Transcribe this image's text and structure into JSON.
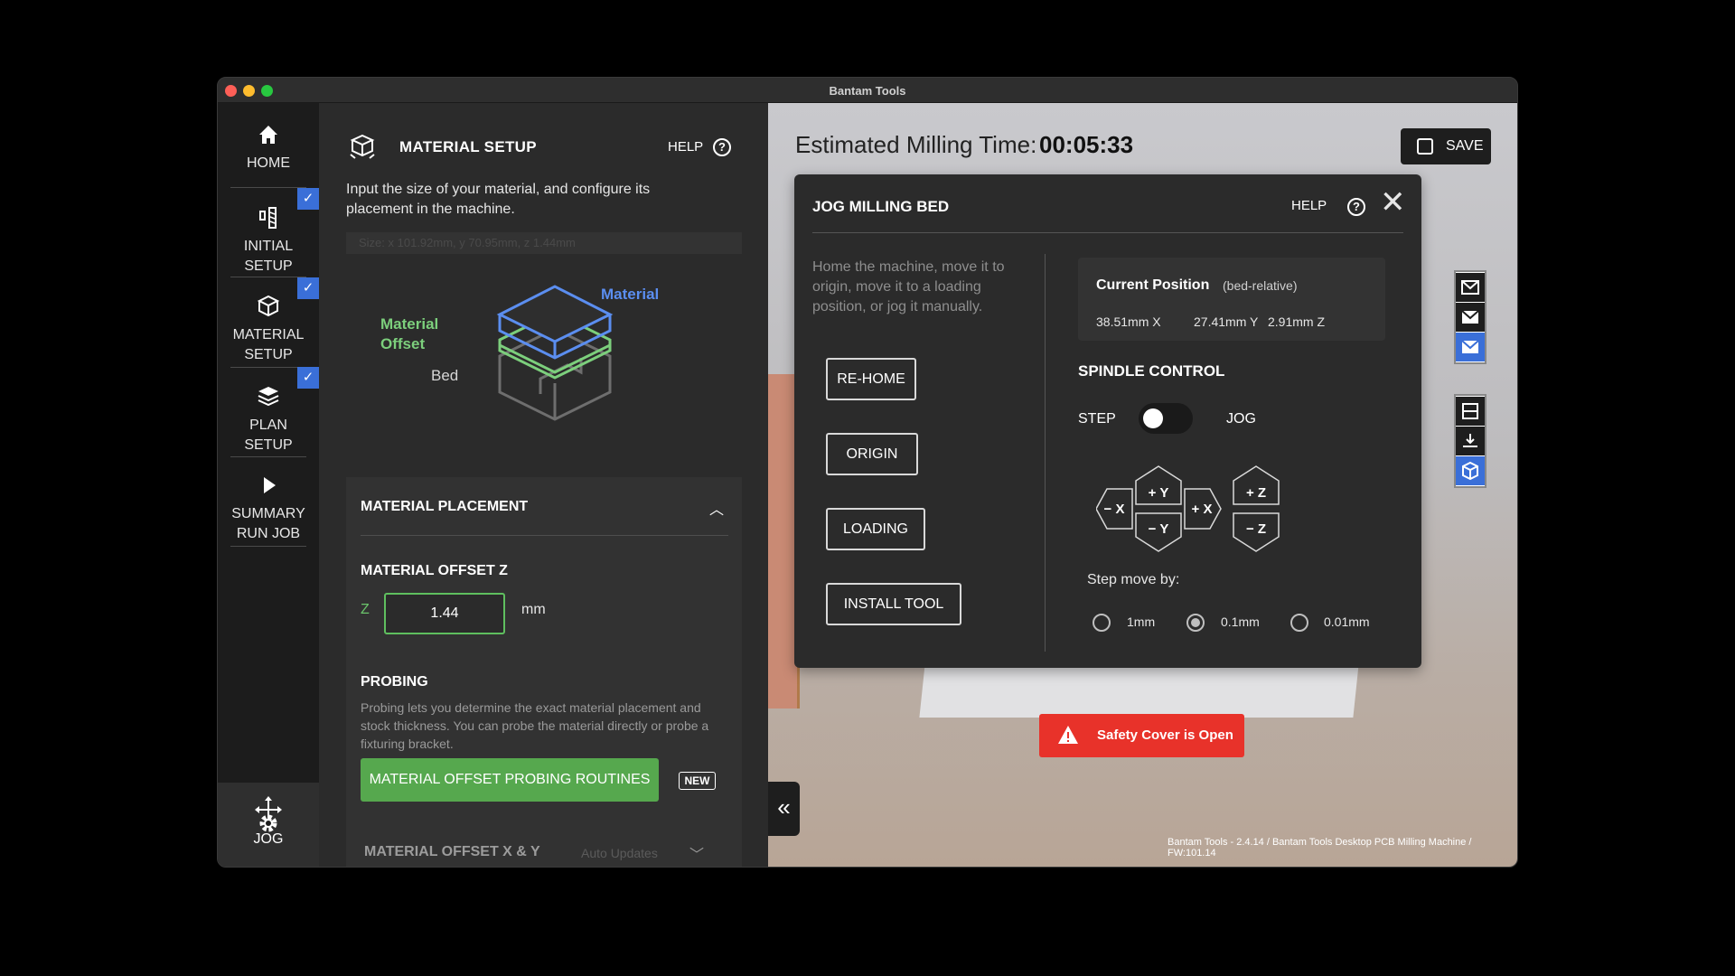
{
  "window": {
    "title": "Bantam Tools"
  },
  "nav": {
    "items": [
      {
        "label_line1": "HOME",
        "label_line2": "",
        "checked": false
      },
      {
        "label_line1": "INITIAL",
        "label_line2": "SETUP",
        "checked": true
      },
      {
        "label_line1": "MATERIAL",
        "label_line2": "SETUP",
        "checked": true
      },
      {
        "label_line1": "PLAN",
        "label_line2": "SETUP",
        "checked": true
      },
      {
        "label_line1": "SUMMARY",
        "label_line2": "RUN JOB",
        "checked": false
      }
    ],
    "jog_label": "JOG",
    "settings_icon": "gear-icon"
  },
  "setup": {
    "title": "MATERIAL SETUP",
    "help_label": "HELP",
    "description": "Input the size of your material, and configure its placement in the machine.",
    "size_text": "Size: x 101.92mm, y 70.95mm, z 1.44mm",
    "diagram": {
      "material_label": "Material",
      "offset_label_line1": "Material",
      "offset_label_line2": "Offset",
      "bed_label": "Bed"
    },
    "placement": {
      "header": "MATERIAL PLACEMENT",
      "offset_z_label": "MATERIAL OFFSET Z",
      "z_axis": "Z",
      "z_value": "1.44",
      "unit": "mm",
      "probing_label": "PROBING",
      "probing_desc": "Probing lets you determine the exact material placement and stock thickness. You can probe the material directly or probe a fixturing bracket.",
      "probe_button": "MATERIAL OFFSET PROBING ROUTINES",
      "new_badge": "NEW",
      "offset_xy_label": "MATERIAL OFFSET X & Y",
      "offset_xy_status": "Auto Updates"
    }
  },
  "viewport": {
    "est_label": "Estimated Milling Time:",
    "est_value": "00:05:33",
    "save_label": "SAVE",
    "version": "Bantam Tools - 2.4.14 / Bantam Tools Desktop PCB Milling Machine / FW:101.14",
    "safety_warning": "Safety Cover is Open"
  },
  "jog": {
    "title": "JOG MILLING BED",
    "help_label": "HELP",
    "description": "Home the machine, move it to origin, move it to a loading position, or jog it manually.",
    "buttons": [
      "RE-HOME",
      "ORIGIN",
      "LOADING",
      "INSTALL TOOL"
    ],
    "current_position": {
      "title": "Current Position",
      "subtitle": "(bed-relative)",
      "x": "38.51mm X",
      "y": "27.41mm Y",
      "z": "2.91mm Z"
    },
    "spindle_title": "SPINDLE CONTROL",
    "step_label": "STEP",
    "jog_label": "JOG",
    "toggle_state": "STEP",
    "pad": {
      "minus_x": "− X",
      "plus_y": "+ Y",
      "minus_y": "− Y",
      "plus_x": "+ X",
      "plus_z": "+ Z",
      "minus_z": "− Z"
    },
    "step_move_label": "Step move by:",
    "step_options": [
      "1mm",
      "0.1mm",
      "0.01mm"
    ],
    "step_selected": "0.1mm"
  },
  "colors": {
    "accent_blue": "#3a6fd8",
    "green": "#56a84e",
    "danger": "#e8322a",
    "material_blue": "#5b8ef0",
    "offset_green": "#7ccf7c"
  }
}
